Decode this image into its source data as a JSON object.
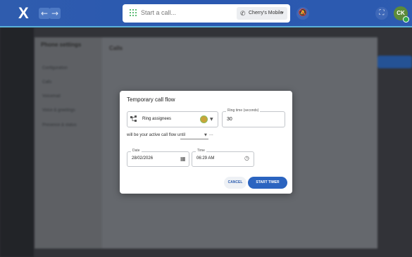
{
  "topbar": {
    "logo_text": "X",
    "back_icon": "arrow-left-icon",
    "forward_icon": "arrow-right-icon",
    "call_placeholder": "Start a call...",
    "device_label": "Cherry's Mobile",
    "dnd_icon": "bell-off-icon",
    "expand_icon": "expand-icon",
    "avatar_initials": "CK",
    "status_color": "#2fa84a",
    "bar_color": "#2d5bb0"
  },
  "background": {
    "panel_title": "Phone settings",
    "panel_header": "Calls",
    "side_items": [
      "Configuration",
      "Calls",
      "Voicemail",
      "Voice & greetings",
      "Presence & status"
    ]
  },
  "dialog": {
    "title": "Temporary call flow",
    "ring_assignees_label": "Ring assignees",
    "ring_time_label": "Ring time (seconds)",
    "ring_time_value": "30",
    "until_text": "will be your active call flow until",
    "ellipsis": "...",
    "date_label": "Date",
    "date_value": "28/02/2026",
    "time_label": "Time",
    "time_value": "06:29 AM",
    "cancel_label": "CANCEL",
    "start_label": "START TIMER",
    "accent_color": "#2b64c0"
  }
}
